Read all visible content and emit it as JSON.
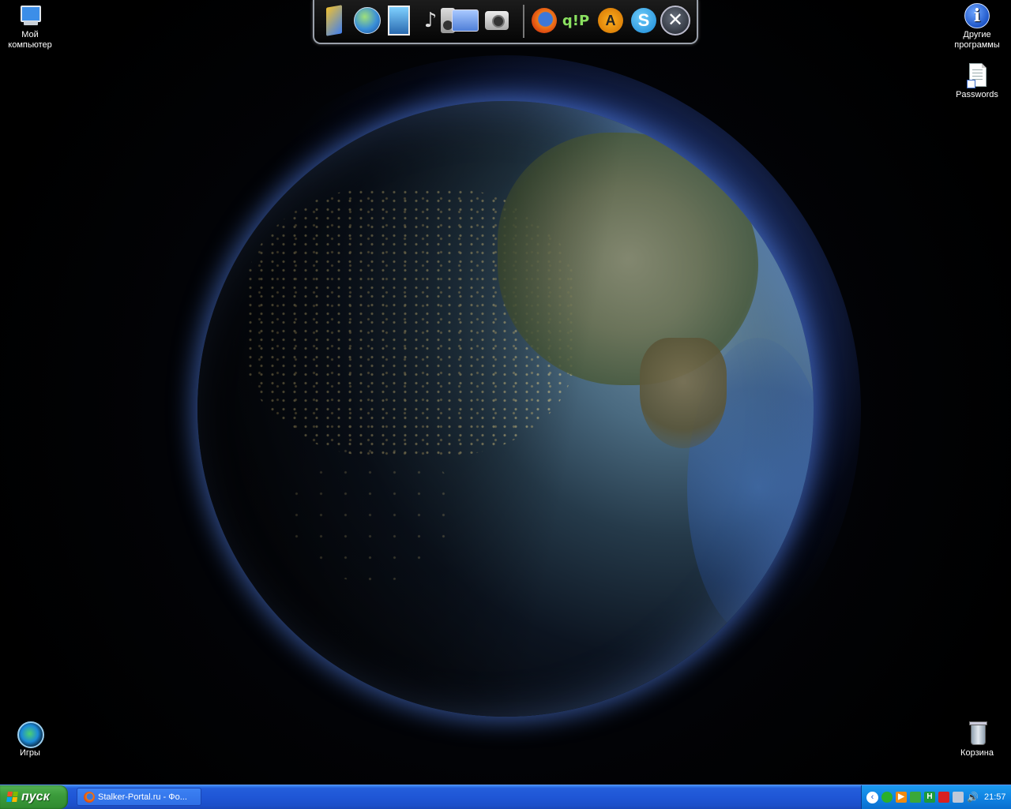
{
  "desktop": {
    "icons": {
      "my_computer": "Мой компьютер",
      "other_programs": "Другие программы",
      "passwords": "Passwords",
      "games": "Игры",
      "recycle_bin": "Корзина"
    },
    "wallpaper": "earth-night-day"
  },
  "dock": {
    "items": [
      "ruler-icon",
      "globe-icon",
      "picture-frames-icon",
      "music-note-icon",
      "speaker-icon",
      "folder-icon",
      "camera-icon",
      "firefox-icon",
      "qip-icon",
      "aimp-icon",
      "skype-icon",
      "close-x-icon"
    ],
    "qip_text": "q!P",
    "aimp_text": "A",
    "skype_text": "S",
    "x_text": "✕",
    "music_glyph": "♪"
  },
  "taskbar": {
    "start_label": "пуск",
    "task_button": "Stalker-Portal.ru - Фо...",
    "tray": {
      "chevron": "‹",
      "icons": [
        "shield-icon",
        "media-play-icon",
        "network-icon",
        "antivirus-icon",
        "network-connection-icon",
        "volume-icon"
      ],
      "clock": "21:57"
    },
    "colors": {
      "taskbar": "#245edb",
      "start": "#3c9c3c",
      "tray": "#0f80e0"
    }
  }
}
